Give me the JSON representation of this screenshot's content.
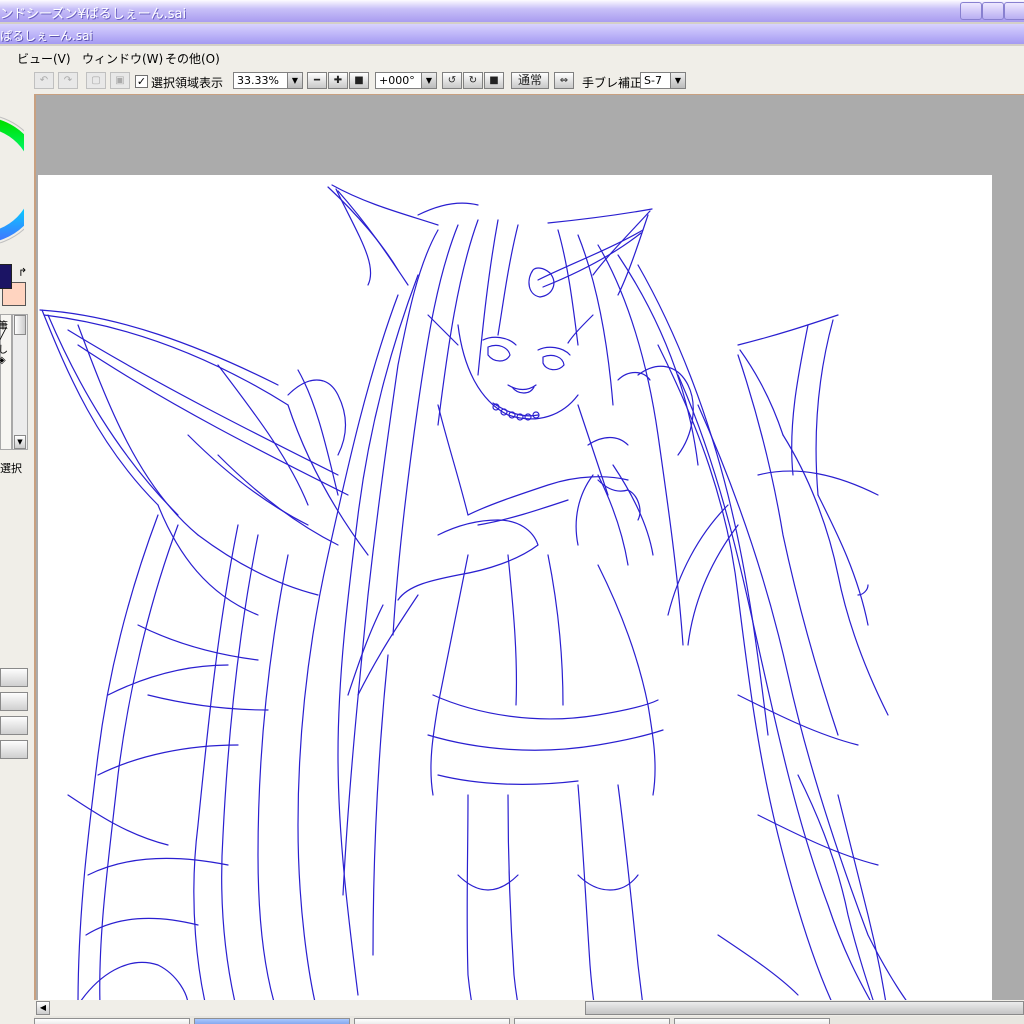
{
  "window": {
    "title": "ンドシーズン¥ぱるしぇーん.sai"
  },
  "document": {
    "title": "ぱるしぇーん.sai"
  },
  "menu": [
    {
      "label": "ビュー(V)"
    },
    {
      "label": "ウィンドウ(W)"
    },
    {
      "label": "その他(O)"
    }
  ],
  "toolbar": {
    "show_selection_label": "選択領域表示",
    "show_selection_checked": true,
    "zoom_value": "33.33%",
    "rotation_value": "+000°",
    "blend_button_label": "通常",
    "stabilizer_label": "手ブレ補正",
    "stabilizer_value": "S-7"
  },
  "left_panel": {
    "colors": {
      "primary": "#1b1464",
      "secondary": "#ffd4c0"
    },
    "tool_glyphs": [
      "筆",
      "し"
    ],
    "selection_label": "選択"
  },
  "canvas": {
    "line_color": "#2a1fd0",
    "paper_color": "#ffffff",
    "backdrop_color": "#ababab"
  }
}
